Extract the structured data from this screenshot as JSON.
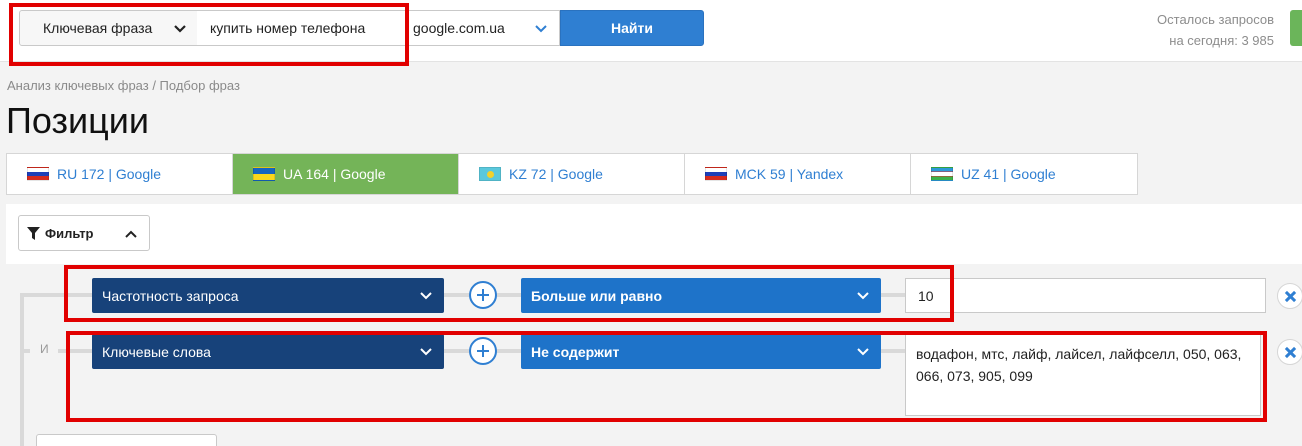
{
  "search": {
    "mode_label": "Ключевая фраза",
    "query_value": "купить номер телефона",
    "engine_label": "google.com.ua",
    "submit_label": "Найти"
  },
  "quota": {
    "line1": "Осталось запросов",
    "line2": "на сегодня: 3 985"
  },
  "breadcrumb": "Анализ ключевых фраз / Подбор фраз",
  "page_title": "Позиции",
  "tabs": [
    {
      "label": "RU 172 | Google",
      "flag": "ru",
      "active": false
    },
    {
      "label": "UA 164 | Google",
      "flag": "ua",
      "active": true
    },
    {
      "label": "KZ 72 | Google",
      "flag": "kz",
      "active": false
    },
    {
      "label": "MCK 59 | Yandex",
      "flag": "ru",
      "active": false
    },
    {
      "label": "UZ 41 | Google",
      "flag": "uz",
      "active": false
    }
  ],
  "filter": {
    "toggle_label": "Фильтр",
    "conjunction": "И",
    "rows": [
      {
        "field": "Частотность запроса",
        "operator": "Больше или равно",
        "value": "10"
      },
      {
        "field": "Ключевые слова",
        "operator": "Не содержит",
        "value": "водафон, мтс, лайф, лайсел, лайфселл, 050, 063, 066, 073, 905, 099"
      }
    ]
  },
  "colors": {
    "accent": "#2f7fd2",
    "active_tab": "#74b458",
    "dark_select": "#17427a",
    "blue_select": "#1e73c9",
    "highlight": "#e10000"
  }
}
